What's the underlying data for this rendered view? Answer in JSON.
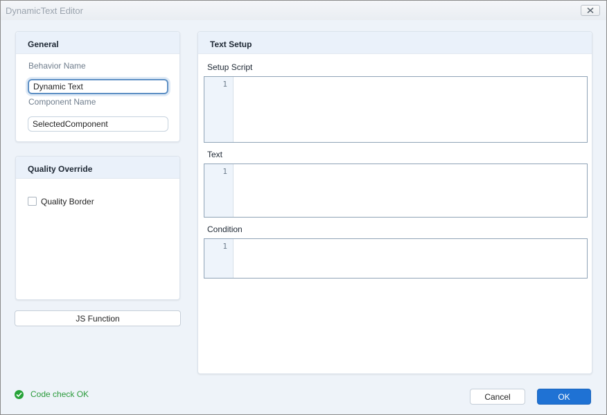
{
  "window": {
    "title": "DynamicText Editor",
    "close_icon": "close-icon"
  },
  "general": {
    "header": "General",
    "behavior_name_label": "Behavior Name",
    "behavior_name_value": "Dynamic Text",
    "component_name_label": "Component Name",
    "component_name_value": "SelectedComponent"
  },
  "quality_override": {
    "header": "Quality Override",
    "quality_border_label": "Quality Border",
    "quality_border_checked": false
  },
  "js_function_button": "JS Function",
  "text_setup": {
    "header": "Text Setup",
    "editors": [
      {
        "label": "Setup Script",
        "line_number": "1"
      },
      {
        "label": "Text",
        "line_number": "1"
      },
      {
        "label": "Condition",
        "line_number": "1"
      }
    ]
  },
  "status": {
    "text": "Code check OK",
    "icon": "check-circle-icon",
    "color": "#27a339"
  },
  "footer": {
    "cancel_label": "Cancel",
    "ok_label": "OK",
    "accent": "#1f72d4"
  }
}
